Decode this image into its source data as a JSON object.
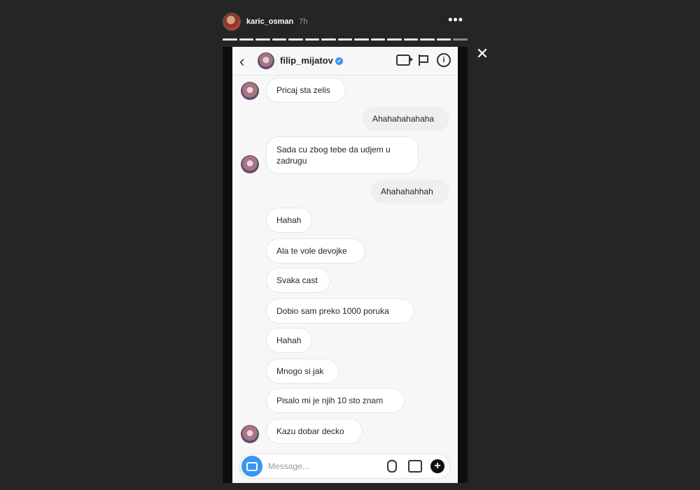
{
  "story": {
    "username": "karic_osman",
    "time": "7h",
    "more_icon": "more-horizontal-icon",
    "close_icon": "close-icon",
    "segments": 15,
    "active_segments": 14
  },
  "chat": {
    "header": {
      "name": "filip_mijatov",
      "verified": true,
      "icons": [
        "back-arrow-icon",
        "video-call-icon",
        "flag-icon",
        "info-icon"
      ]
    },
    "messages": [
      {
        "side": "in",
        "text": "Pricaj sta zelis",
        "avatar": true
      },
      {
        "side": "out",
        "text": "Ahahahahahaha"
      },
      {
        "side": "in",
        "text": "Sada cu zbog tebe da udjem u zadrugu",
        "avatar": true
      },
      {
        "side": "out",
        "text": "Ahahahahhah"
      },
      {
        "side": "in",
        "text": "Hahah"
      },
      {
        "side": "in",
        "text": "Ala te vole devojke"
      },
      {
        "side": "in",
        "text": "Svaka cast"
      },
      {
        "side": "in",
        "text": "Dobio sam preko 1000 poruka"
      },
      {
        "side": "in",
        "text": "Hahah"
      },
      {
        "side": "in",
        "text": "Mnogo si jak"
      },
      {
        "side": "in",
        "text": "Pisalo mi je njih 10 sto znam"
      },
      {
        "side": "in",
        "text": "Kazu dobar decko",
        "avatar": true
      }
    ],
    "composer": {
      "placeholder": "Message...",
      "icons": [
        "camera-icon",
        "microphone-icon",
        "gallery-icon",
        "plus-icon"
      ]
    }
  },
  "colors": {
    "background": "#252525",
    "accent": "#3897f0"
  }
}
